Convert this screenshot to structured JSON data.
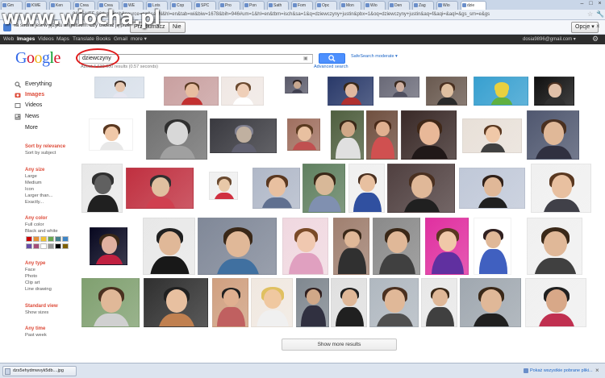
{
  "browser": {
    "tabs": [
      "Gm",
      "KWE",
      "Ken",
      "Crea",
      "Crea",
      "WE",
      "Lots",
      "Cop",
      "SPC",
      "Pro",
      "Pon",
      "Sath",
      "Fom",
      "Opc",
      "Mon",
      "Wio",
      "Den",
      "Zag",
      "Wio",
      "dzie"
    ],
    "url": "2&ie=UTF-8&tbm=isch&source=og&sa=N&hl=en&tab=wi&biw=1678&bih=946#um=1&hl=en&tbm=isch&sa=1&q=dziewczyny+justin&pbx=1&oq=dziewczyny+justin&aq=f&aqi=&aql=&gs_sm=e&gs",
    "window_controls": [
      "–",
      "□",
      "×"
    ]
  },
  "translate_bar": {
    "text": "Ta strona jest w języku angielskim. Czy chcesz ją przetłumaczyć?",
    "translate_button": "Przetłumacz",
    "no_button": "Nie",
    "options_button": "Opcje",
    "close": "×"
  },
  "watermark": "www.wiocha.pl",
  "google_bar": {
    "items": [
      "Web",
      "Images",
      "Videos",
      "Maps",
      "Translate",
      "Books",
      "Gmail",
      "more ▾"
    ],
    "active": "Images",
    "user": "dosia9896@gmail.com ▾"
  },
  "search": {
    "logo_letters": [
      {
        "ch": "G",
        "color": "#3369e8"
      },
      {
        "ch": "o",
        "color": "#d50f25"
      },
      {
        "ch": "o",
        "color": "#eeb211"
      },
      {
        "ch": "g",
        "color": "#3369e8"
      },
      {
        "ch": "l",
        "color": "#009925"
      },
      {
        "ch": "e",
        "color": "#d50f25"
      }
    ],
    "query": "dziewczyny",
    "button_icon": "magnifier-icon",
    "advanced": "Advanced search",
    "safesearch": "SafeSearch moderate ▾",
    "stats": "About 4 630 000 results (0.57 seconds)"
  },
  "nav": {
    "items": [
      {
        "label": "Everything",
        "icon": "everything-icon"
      },
      {
        "label": "Images",
        "icon": "images-icon"
      },
      {
        "label": "Videos",
        "icon": "videos-icon"
      },
      {
        "label": "News",
        "icon": "news-icon"
      },
      {
        "label": "More",
        "icon": ""
      }
    ],
    "active": "Images",
    "sort": {
      "head": "Sort by relevance",
      "items": [
        "Sort by subject"
      ]
    },
    "size": {
      "head": "Any size",
      "items": [
        "Large",
        "Medium",
        "Icon",
        "Larger than...",
        "Exactly..."
      ]
    },
    "color": {
      "head": "Any color",
      "items": [
        "Full color",
        "Black and white"
      ],
      "swatches": [
        "#cc0000",
        "#e69138",
        "#f1c232",
        "#6aa84f",
        "#45818e",
        "#3d85c6",
        "#674ea7",
        "#a64d79",
        "#ffffff",
        "#999999",
        "#000000",
        "#7f6000"
      ]
    },
    "type": {
      "head": "Any type",
      "items": [
        "Face",
        "Photo",
        "Clip art",
        "Line drawing"
      ]
    },
    "view": {
      "head": "Standard view",
      "items": [
        "Show sizes"
      ]
    },
    "time": {
      "head": "Any time",
      "items": [
        "Past week"
      ]
    }
  },
  "more_results": "Show more results",
  "download_bar": {
    "file": "dzs5ehydmwvyk5db....jpg",
    "show_all": "Pokaż wszystkie pobrane pliki...",
    "close": "×"
  }
}
